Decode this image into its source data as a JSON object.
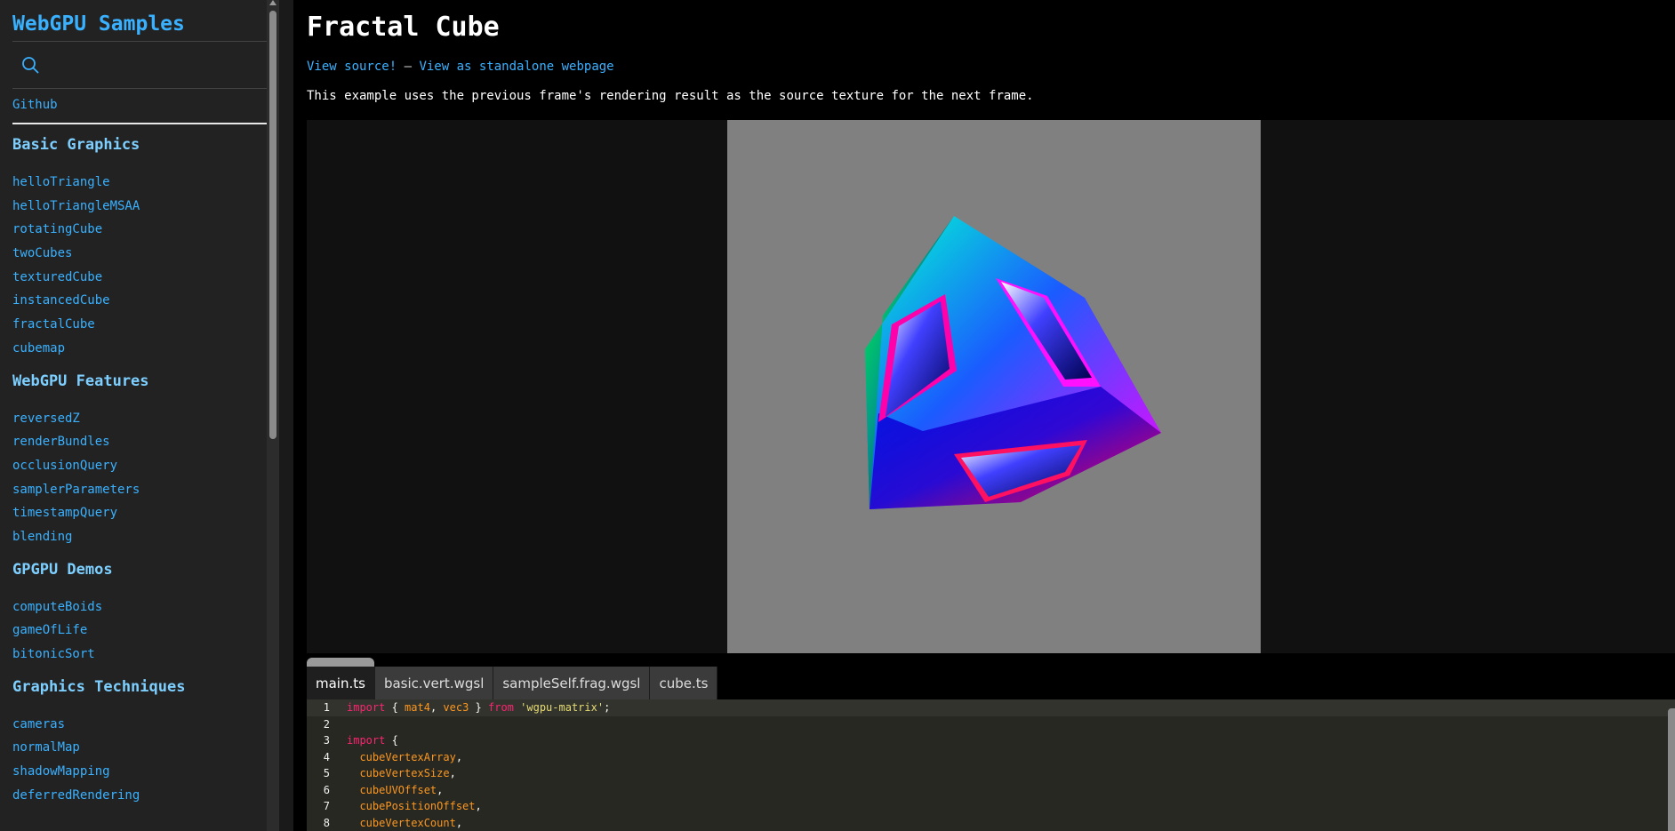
{
  "sidebar": {
    "app_title": "WebGPU Samples",
    "github_label": "Github",
    "sections": [
      {
        "title": "Basic Graphics",
        "items": [
          "helloTriangle",
          "helloTriangleMSAA",
          "rotatingCube",
          "twoCubes",
          "texturedCube",
          "instancedCube",
          "fractalCube",
          "cubemap"
        ]
      },
      {
        "title": "WebGPU Features",
        "items": [
          "reversedZ",
          "renderBundles",
          "occlusionQuery",
          "samplerParameters",
          "timestampQuery",
          "blending"
        ]
      },
      {
        "title": "GPGPU Demos",
        "items": [
          "computeBoids",
          "gameOfLife",
          "bitonicSort"
        ]
      },
      {
        "title": "Graphics Techniques",
        "items": [
          "cameras",
          "normalMap",
          "shadowMapping",
          "deferredRendering"
        ]
      }
    ]
  },
  "main": {
    "title": "Fractal Cube",
    "view_source": "View source!",
    "separator": " — ",
    "standalone": "View as standalone webpage",
    "description": "This example uses the previous frame's rendering result as the source texture for the next frame."
  },
  "tabs": [
    "main.ts",
    "basic.vert.wgsl",
    "sampleSelf.frag.wgsl",
    "cube.ts"
  ],
  "code": {
    "line_numbers": [
      "1",
      "2",
      "3",
      "4",
      "5",
      "6",
      "7",
      "8"
    ],
    "l1_kw1": "import",
    "l1_p1": " { ",
    "l1_id1": "mat4",
    "l1_p2": ", ",
    "l1_id2": "vec3",
    "l1_p3": " } ",
    "l1_kw2": "from",
    "l1_p4": " ",
    "l1_str": "'wgpu-matrix'",
    "l1_p5": ";",
    "l3_kw": "import",
    "l3_p": " {",
    "l4": "cubeVertexArray",
    "l5": "cubeVertexSize",
    "l6": "cubeUVOffset",
    "l7": "cubePositionOffset",
    "l8": "cubeVertexCount",
    "comma": ","
  },
  "colors": {
    "link": "#3ab1ff",
    "section_heading": "#7dcfff",
    "canvas_bg": "#808080",
    "editor_bg": "#272822",
    "keyword": "#f92672",
    "identifier": "#fd971f",
    "string": "#e6db74"
  },
  "icons": {
    "search": "search-icon"
  }
}
